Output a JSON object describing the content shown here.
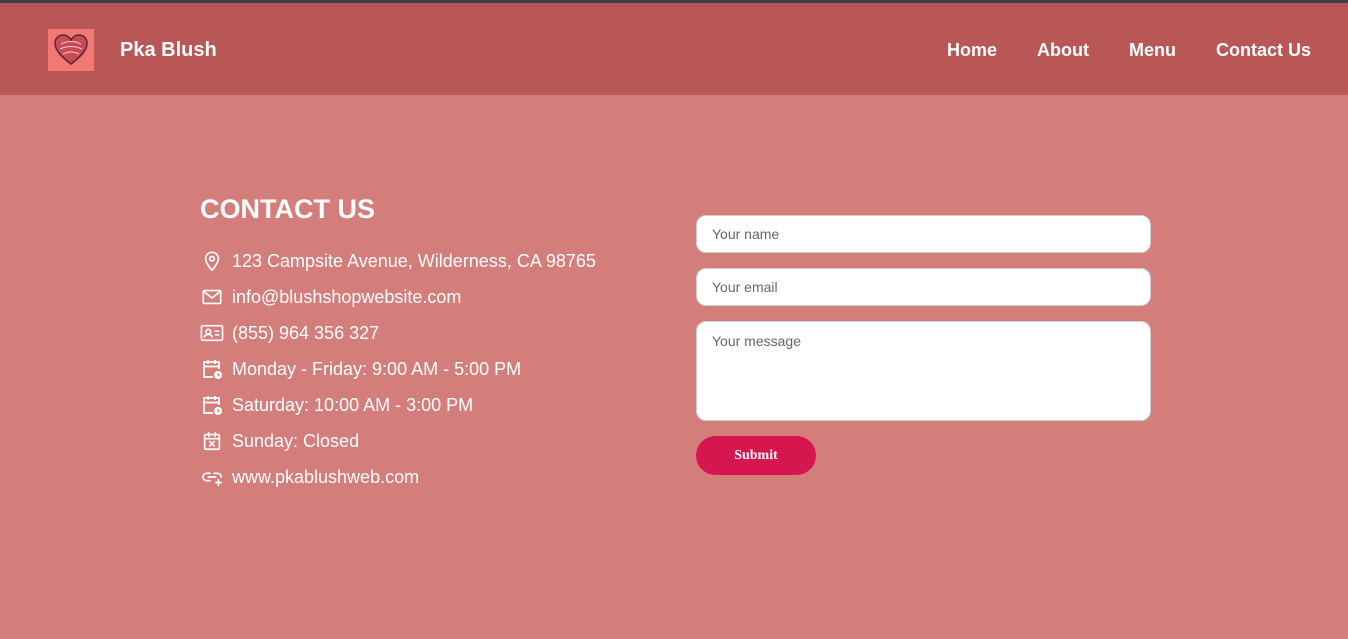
{
  "header": {
    "brand": "Pka Blush",
    "logo_icon": "heart-logo-icon",
    "nav": [
      {
        "label": "Home"
      },
      {
        "label": "About"
      },
      {
        "label": "Menu"
      },
      {
        "label": "Contact Us"
      }
    ]
  },
  "contact": {
    "title": "CONTACT US",
    "items": [
      {
        "icon": "map-pin-icon",
        "text": "123 Campsite Avenue, Wilderness, CA 98765"
      },
      {
        "icon": "mail-icon",
        "text": "info@blushshopwebsite.com"
      },
      {
        "icon": "contact-card-icon",
        "text": "(855) 964 356 327"
      },
      {
        "icon": "calendar-clock-icon",
        "text": "Monday - Friday: 9:00 AM - 5:00 PM"
      },
      {
        "icon": "calendar-clock-icon",
        "text": "Saturday: 10:00 AM - 3:00 PM"
      },
      {
        "icon": "calendar-x-icon",
        "text": "Sunday: Closed"
      },
      {
        "icon": "link-icon",
        "text": "www.pkablushweb.com"
      }
    ]
  },
  "form": {
    "name_placeholder": "Your name",
    "email_placeholder": "Your email",
    "message_placeholder": "Your message",
    "submit_label": "Submit"
  },
  "colors": {
    "page_bg": "#d47e7b",
    "header_bg": "#b95656",
    "submit_bg": "#d6174f",
    "logo_bg": "#f07a73"
  }
}
